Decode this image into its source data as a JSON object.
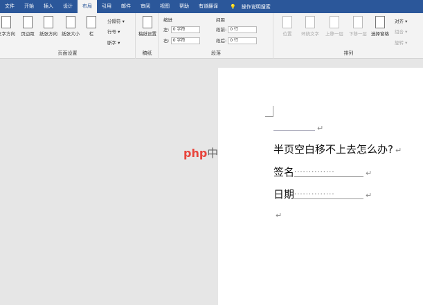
{
  "tabs": [
    "文件",
    "开始",
    "插入",
    "设计",
    "布局",
    "引用",
    "邮件",
    "审阅",
    "视图",
    "帮助",
    "有道翻译"
  ],
  "search_label": "操作说明搜索",
  "ribbon": {
    "page_setup": {
      "label": "页面设置",
      "text_direction": "文字方向",
      "margins": "页边距",
      "orientation": "纸张方向",
      "size": "纸张大小",
      "columns": "栏",
      "breaks": "分隔符 ▾",
      "line_numbers": "行号 ▾",
      "hyphenation": "断字 ▾"
    },
    "draft": {
      "label": "稿纸",
      "button": "稿纸设置"
    },
    "indent": {
      "title": "缩进",
      "left_label": "左:",
      "left_value": "0 字符",
      "right_label": "右:",
      "right_value": "0 字符"
    },
    "spacing": {
      "title": "间距",
      "before_label": "段前:",
      "before_value": "0 行",
      "after_label": "段后:",
      "after_value": "0 行"
    },
    "paragraph_label": "段落",
    "arrange": {
      "label": "排列",
      "position": "位置",
      "wrap": "环绕文字",
      "forward": "上移一层",
      "backward": "下移一层",
      "pane": "选择窗格",
      "align": "对齐 ▾",
      "group": "组合 ▾",
      "rotate": "旋转 ▾"
    }
  },
  "document": {
    "line1": "半页空白移不上去怎么办?",
    "sign_label": "签名",
    "date_label": "日期",
    "dots": "··············",
    "return_mark": "↵"
  },
  "watermark": {
    "brand": "php",
    "text": "中文网"
  }
}
